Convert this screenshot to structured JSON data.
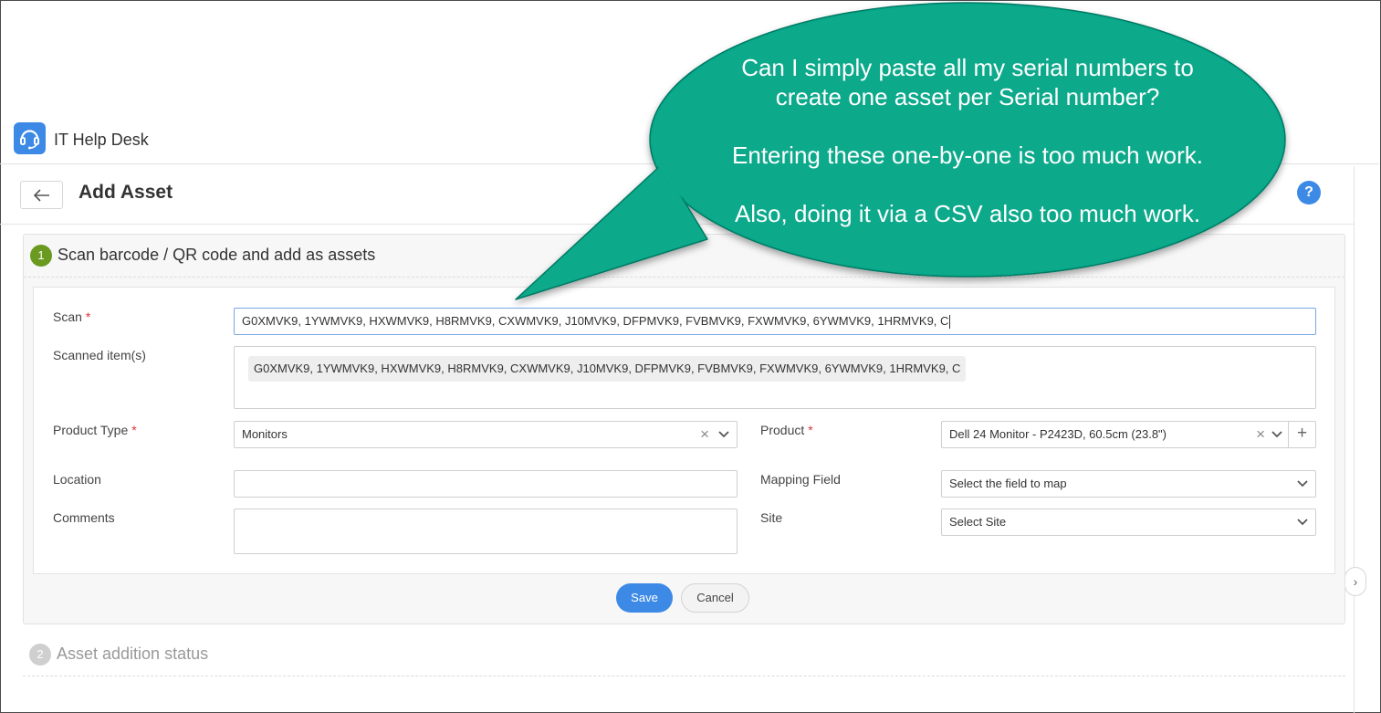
{
  "app": {
    "title": "IT Help Desk",
    "logo_icon": "headset-icon",
    "accent": "#3d8ae6"
  },
  "page": {
    "title": "Add Asset",
    "back_icon": "arrow-left-icon",
    "help_label": "?"
  },
  "section1": {
    "step": "1",
    "title": "Scan barcode / QR code and add as assets",
    "step_color": "#6a9a1f"
  },
  "form": {
    "scan": {
      "label": "Scan",
      "required": "*",
      "value": "G0XMVK9, 1YWMVK9, HXWMVK9, H8RMVK9, CXWMVK9, J10MVK9, DFPMVK9, FVBMVK9, FXWMVK9, 6YWMVK9, 1HRMVK9, C"
    },
    "scanned": {
      "label": "Scanned item(s)",
      "items": [
        "G0XMVK9, 1YWMVK9, HXWMVK9, H8RMVK9, CXWMVK9, J10MVK9, DFPMVK9, FVBMVK9, FXWMVK9, 6YWMVK9, 1HRMVK9, C"
      ]
    },
    "product_type": {
      "label": "Product Type",
      "required": "*",
      "value": "Monitors"
    },
    "product": {
      "label": "Product",
      "required": "*",
      "value": "Dell 24 Monitor - P2423D, 60.5cm (23.8\")"
    },
    "location": {
      "label": "Location",
      "value": ""
    },
    "mapping_field": {
      "label": "Mapping Field",
      "value": "Select the field to map"
    },
    "comments": {
      "label": "Comments",
      "value": ""
    },
    "site": {
      "label": "Site",
      "value": "Select Site"
    }
  },
  "actions": {
    "save": "Save",
    "cancel": "Cancel"
  },
  "section2": {
    "step": "2",
    "title": "Asset addition status"
  },
  "callout": {
    "color": "#07a98b",
    "lines": [
      "Can I simply paste all my serial numbers to",
      "create one asset per Serial number?",
      "",
      "Entering these one-by-one is too much work.",
      "",
      "Also, doing it via a CSV also too much work."
    ]
  }
}
